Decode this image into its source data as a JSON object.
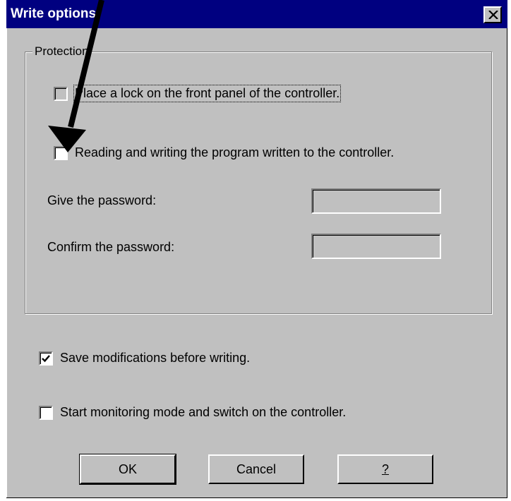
{
  "window": {
    "title": "Write options"
  },
  "titlebar": {
    "close_icon": "close-icon"
  },
  "protection": {
    "label": "Protection",
    "lock_panel": {
      "label": "Place a lock on the front panel of the controller.",
      "checked": false,
      "enabled": false
    },
    "read_write": {
      "label": "Reading and writing the program written to the controller.",
      "checked": false
    },
    "password": {
      "label": "Give the password:",
      "value": ""
    },
    "confirm_password": {
      "label": "Confirm the password:",
      "value": ""
    }
  },
  "options": {
    "save_modifications": {
      "label": "Save modifications before writing.",
      "checked": true
    },
    "start_monitoring": {
      "label": "Start monitoring mode and switch on the controller.",
      "checked": false
    }
  },
  "buttons": {
    "ok": "OK",
    "cancel": "Cancel",
    "help": "?"
  },
  "annotation": {
    "icon": "arrow-pointer-icon",
    "color": "#000000"
  }
}
